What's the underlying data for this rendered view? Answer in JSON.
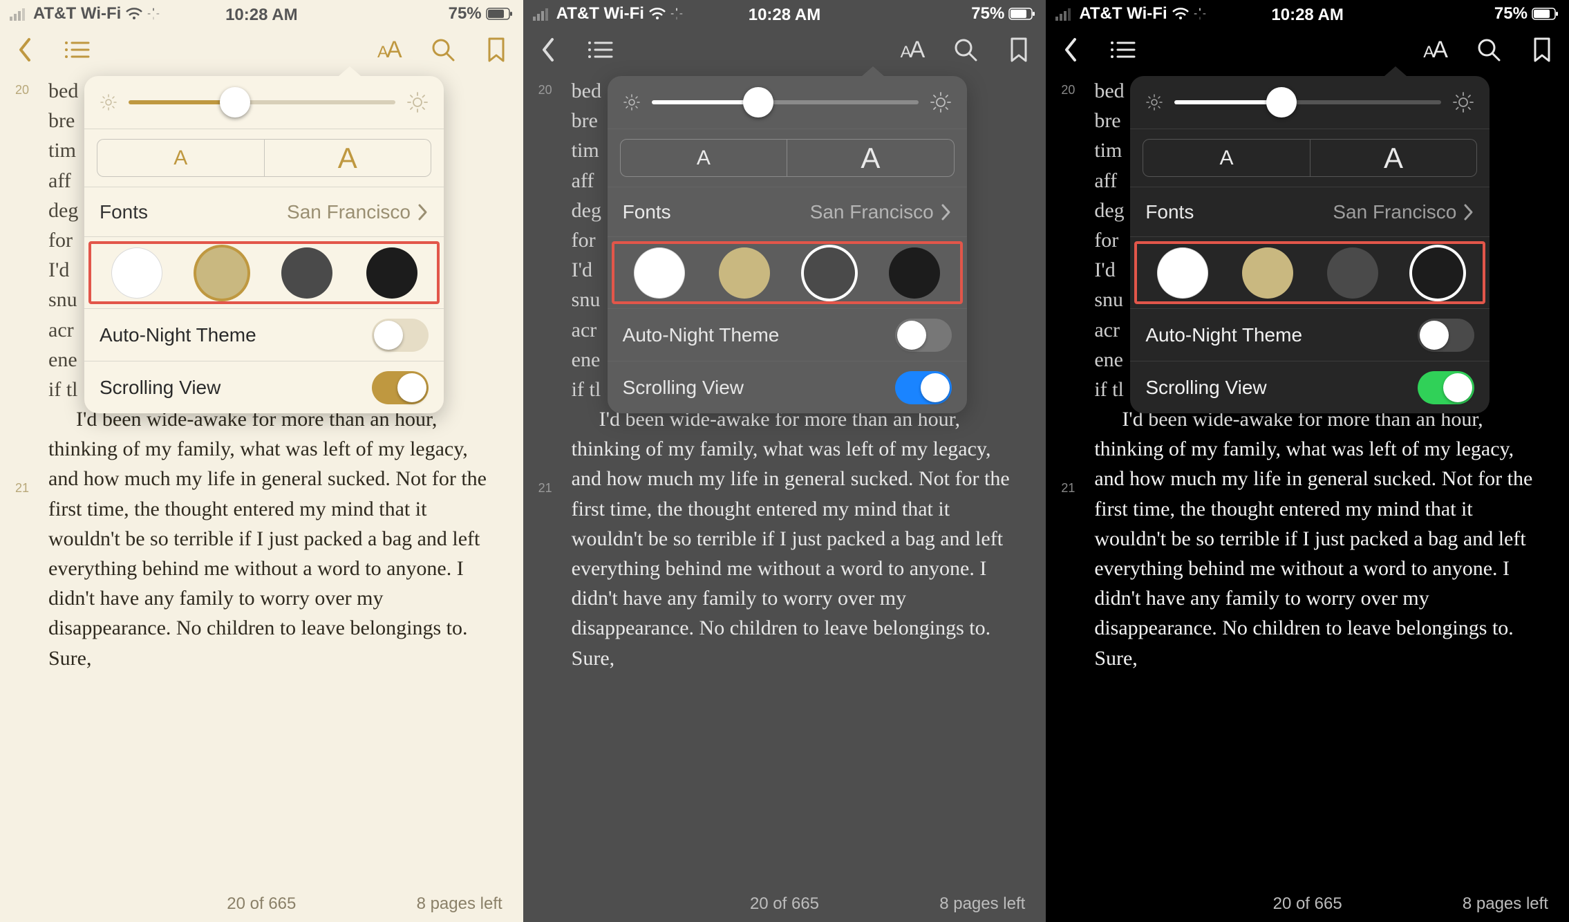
{
  "status": {
    "carrier": "AT&T Wi-Fi",
    "time": "10:28 AM",
    "battery": "75%"
  },
  "reader": {
    "lineNumbers": [
      "20",
      "21"
    ],
    "truncatedLines": [
      "bed",
      "bre",
      "tim",
      "aff",
      "deg",
      "for",
      "I'd",
      "snu",
      "acr",
      "ene",
      "if tl"
    ],
    "paragraph": "I'd been wide-awake for more than an hour, thinking of my family, what was left of my legacy, and how much my life in general sucked. Not for the first time, the thought entered my mind that it wouldn't be so terrible if I just packed a bag and left everything behind me without a word to anyone. I didn't have any family to worry over my disappearance. No children to leave belongings to. Sure,"
  },
  "footer": {
    "pos": "20 of 665",
    "pagesLeft": "8 pages left"
  },
  "popover": {
    "smallA": "A",
    "largeA": "A",
    "fontsLabel": "Fonts",
    "fontValue": "San Francisco",
    "swatches": [
      "#ffffff",
      "#c9b880",
      "#4a4a4a",
      "#1c1c1c"
    ],
    "autoNightLabel": "Auto-Night Theme",
    "scrollingLabel": "Scrolling View"
  },
  "screens": [
    {
      "theme": "white",
      "selectedSwatch": 1
    },
    {
      "theme": "grey",
      "selectedSwatch": 2
    },
    {
      "theme": "black",
      "selectedSwatch": 3
    }
  ]
}
